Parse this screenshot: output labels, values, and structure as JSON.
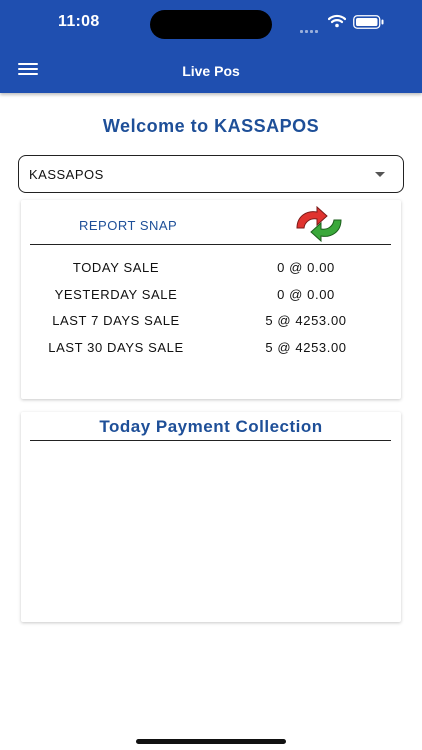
{
  "status_bar": {
    "time": "11:08"
  },
  "header": {
    "title": "Live Pos",
    "menu_icon": "hamburger-icon"
  },
  "welcome": {
    "text": "Welcome to KASSAPOS"
  },
  "store_select": {
    "value": "KASSAPOS"
  },
  "report": {
    "title": "REPORT SNAP",
    "refresh_icon": "refresh-icon",
    "rows": [
      {
        "label": "TODAY SALE",
        "value": "0 @ 0.00"
      },
      {
        "label": "YESTERDAY SALE",
        "value": "0 @ 0.00"
      },
      {
        "label": "LAST 7 DAYS SALE",
        "value": "5 @ 4253.00"
      },
      {
        "label": "LAST 30 DAYS SALE",
        "value": "5 @ 4253.00"
      }
    ]
  },
  "payment": {
    "title": "Today Payment Collection"
  },
  "colors": {
    "header_bg": "#1f4fb0",
    "accent_text": "#1e4f98",
    "refresh_red": "#e0332f",
    "refresh_green": "#3aa83a"
  }
}
